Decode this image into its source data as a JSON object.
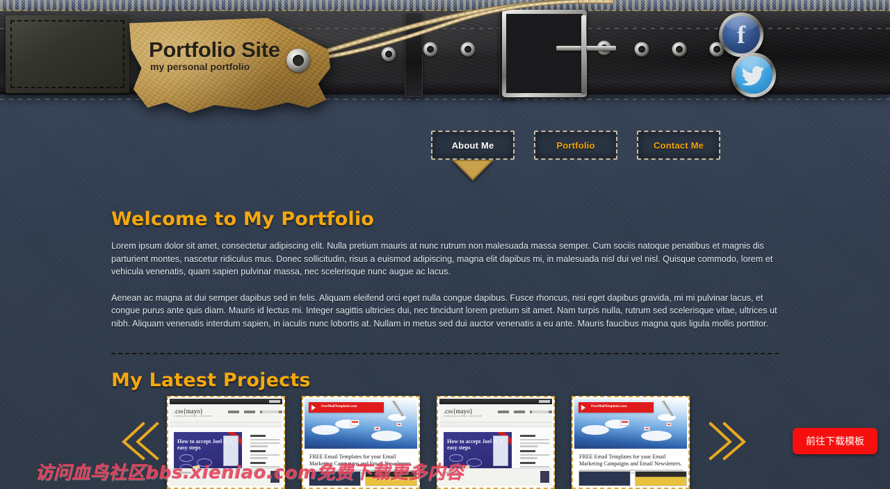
{
  "site": {
    "title": "Portfolio Site",
    "tagline": "my personal portfolio"
  },
  "social": {
    "facebook_label": "f",
    "facebook_name": "facebook-icon",
    "twitter_label": "t",
    "twitter_name": "twitter-icon"
  },
  "nav": {
    "items": [
      {
        "label": "About Me",
        "active": true
      },
      {
        "label": "Portfolio",
        "active": false
      },
      {
        "label": "Contact Me",
        "active": false
      }
    ]
  },
  "welcome": {
    "heading": "Welcome to My Portfolio",
    "paragraph_1": "Lorem ipsum dolor sit amet, consectetur adipiscing elit. Nulla pretium mauris at nunc rutrum non malesuada massa semper. Cum sociis natoque penatibus et magnis dis parturient montes, nascetur ridiculus mus. Donec sollicitudin, risus a euismod adipiscing, magna elit dapibus mi, in malesuada nisl dui vel nisl. Quisque commodo, lorem et vehicula venenatis, quam sapien pulvinar massa, nec scelerisque nunc augue ac lacus.",
    "paragraph_2": "Aenean ac magna at dui semper dapibus sed in felis. Aliquam eleifend orci eget nulla congue dapibus. Fusce rhoncus, nisi eget dapibus gravida, mi mi pulvinar lacus, et congue purus ante quis diam. Mauris id lectus mi. Integer sagittis ultricies dui, nec tincidunt lorem pretium sit amet. Nam turpis nulla, rutrum sed scelerisque vitae, ultrices ut nibh. Aliquam venenatis interdum sapien, in iaculis nunc lobortis at. Nullam in metus sed dui auctor venenatis a eu ante. Mauris faucibus magna quis ligula mollis porttitor."
  },
  "projects": {
    "heading": "My Latest Projects",
    "prev_label": "previous",
    "next_label": "next",
    "thumbnails": [
      {
        "kind": "cssmayo",
        "brand": ".css{mayo}",
        "brand_sub": "a weblog about design, code & more",
        "hero_text": "How to accept Joel in 3 easy steps"
      },
      {
        "kind": "freemail",
        "brand": "FreeMailTemplates.com",
        "hero_text": "FREE Email Templates for your Email Marketing Campaigns and Email Newsletters."
      },
      {
        "kind": "cssmayo",
        "brand": ".css{mayo}",
        "brand_sub": "a weblog about design, code & more",
        "hero_text": "How to accept Joel in 3 easy steps"
      },
      {
        "kind": "freemail",
        "brand": "FreeMailTemplates.com",
        "hero_text": "FREE Email Templates for your Email Marketing Campaigns and Email Newsletters."
      }
    ]
  },
  "download_button": {
    "label": "前往下载模板"
  },
  "watermark": {
    "text": "访问血鸟社区bbs.xieniao.com免费下载更多内容"
  },
  "colors": {
    "denim": "#2f3d52",
    "accent_gold": "#f5a80d",
    "nav_gold": "#f2a60c",
    "tag_gold": "#b98f3f",
    "download_red": "#f5100f",
    "watermark_red": "#e8455f",
    "body_text": "#e3e9f2"
  }
}
